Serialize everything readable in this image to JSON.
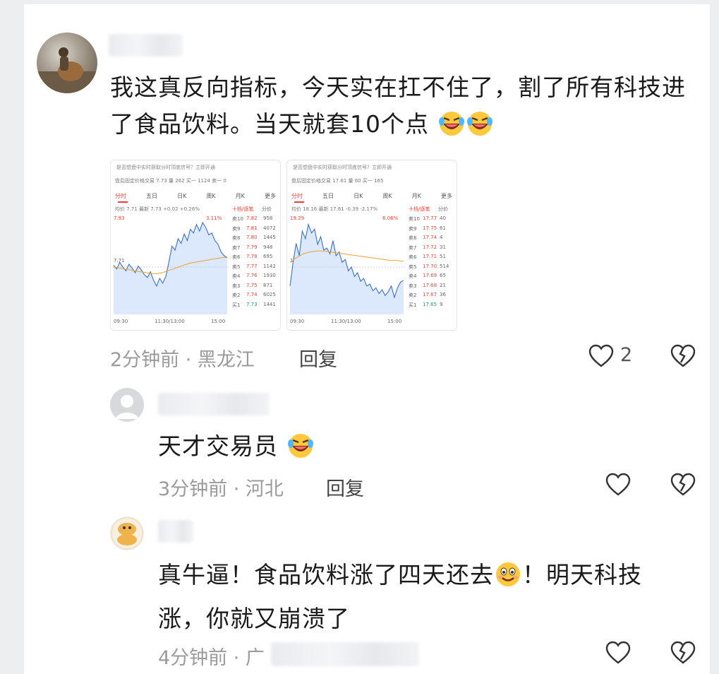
{
  "comments": [
    {
      "text_line1": "我这真反向指标，今天实在扛不住了，割了所有科技进",
      "text_line2": "了食品饮料。当天就套10个点",
      "time_location": "2分钟前 · 黑龙江",
      "reply_label": "回复",
      "like_count": "2",
      "images": [
        {
          "banner": "是否想盘中实时获取分时顶底信号？立即开通",
          "quote": "盘后固定价格交易 7.73 量 262 买一 1124 卖一 0",
          "tabs": [
            "分时",
            "五日",
            "日K",
            "周K",
            "月K",
            "更多"
          ],
          "stats": "均价 7.71 最新 7.73 +0.02 +0.26%",
          "top_price": "7.93",
          "top_pct": "3.11%",
          "bottom_price": "7.47",
          "bottom_pct": "-3.11%",
          "mid_label": "7.71",
          "axis_left": "09:30",
          "axis_mid": "11:30/13:00",
          "axis_right": "15:00",
          "book_header": "十档/逐笔",
          "book_header2": "分价",
          "book": [
            {
              "l": "卖10",
              "p": "7.82",
              "v": "958"
            },
            {
              "l": "卖9",
              "p": "7.81",
              "v": "4072"
            },
            {
              "l": "卖8",
              "p": "7.80",
              "v": "1445"
            },
            {
              "l": "卖7",
              "p": "7.79",
              "v": "948"
            },
            {
              "l": "卖6",
              "p": "7.78",
              "v": "695"
            },
            {
              "l": "卖5",
              "p": "7.77",
              "v": "1142"
            },
            {
              "l": "卖4",
              "p": "7.76",
              "v": "1930"
            },
            {
              "l": "卖3",
              "p": "7.75",
              "v": "871"
            },
            {
              "l": "卖2",
              "p": "7.74",
              "v": "6025"
            },
            {
              "l": "买1",
              "p": "7.73",
              "v": "1441"
            }
          ],
          "price_series": [
            0.52,
            0.48,
            0.55,
            0.5,
            0.46,
            0.53,
            0.49,
            0.44,
            0.51,
            0.47,
            0.42,
            0.39,
            0.45,
            0.36,
            0.3,
            0.38,
            0.33,
            0.4,
            0.55,
            0.72,
            0.68,
            0.8,
            0.75,
            0.85,
            0.78,
            0.9,
            0.86,
            0.95,
            0.88,
            0.97,
            0.92,
            0.84,
            0.86,
            0.78,
            0.74,
            0.66,
            0.62,
            0.6
          ],
          "avg_series": [
            0.5,
            0.49,
            0.48,
            0.47,
            0.46,
            0.45,
            0.44,
            0.43,
            0.43,
            0.44,
            0.46,
            0.48,
            0.5,
            0.52,
            0.54,
            0.55,
            0.56,
            0.57,
            0.58,
            0.59,
            0.6,
            0.6
          ],
          "signal_color": "#ff3b30"
        },
        {
          "banner": "是否想盘中实时获取分时顶底信号？立即开通",
          "quote": "盘后固定价格交易 17.61 量 60 买一 165",
          "tabs": [
            "分时",
            "五日",
            "日K",
            "周K",
            "月K",
            "更多"
          ],
          "stats": "均价 18.16 最新 17.61 -0.39 -2.17%",
          "top_price": "19.29",
          "top_pct": "6.06%",
          "bottom_price": "16.91",
          "bottom_pct": "-6.06%",
          "mid_label": "18.16",
          "axis_left": "09:30",
          "axis_mid": "11:30/13:00",
          "axis_right": "15:00",
          "book_header": "十档/逐笔",
          "book_header2": "分价",
          "book": [
            {
              "l": "卖10",
              "p": "17.77",
              "v": "40"
            },
            {
              "l": "卖9",
              "p": "17.75",
              "v": "61"
            },
            {
              "l": "卖8",
              "p": "17.74",
              "v": "4"
            },
            {
              "l": "卖7",
              "p": "17.72",
              "v": "31"
            },
            {
              "l": "卖6",
              "p": "17.71",
              "v": "51"
            },
            {
              "l": "卖5",
              "p": "17.70",
              "v": "514"
            },
            {
              "l": "卖4",
              "p": "17.69",
              "v": "65"
            },
            {
              "l": "卖3",
              "p": "17.68",
              "v": "21"
            },
            {
              "l": "卖2",
              "p": "17.67",
              "v": "36"
            },
            {
              "l": "买1",
              "p": "17.65",
              "v": "9"
            }
          ],
          "price_series": [
            0.3,
            0.55,
            0.75,
            0.62,
            0.88,
            0.8,
            0.95,
            0.86,
            0.9,
            0.74,
            0.82,
            0.68,
            0.7,
            0.64,
            0.78,
            0.62,
            0.66,
            0.55,
            0.58,
            0.46,
            0.5,
            0.4,
            0.44,
            0.35,
            0.38,
            0.3,
            0.32,
            0.25,
            0.28,
            0.22,
            0.26,
            0.2,
            0.24,
            0.3,
            0.18,
            0.28,
            0.34,
            0.36
          ],
          "avg_series": [
            0.55,
            0.6,
            0.64,
            0.66,
            0.67,
            0.67,
            0.66,
            0.65,
            0.64,
            0.63,
            0.62,
            0.61,
            0.6,
            0.59,
            0.58,
            0.57,
            0.57,
            0.56
          ],
          "signal_color": "#ff3b30"
        }
      ]
    },
    {
      "text_line1": "天才交易员",
      "time_location": "3分钟前 · 河北",
      "reply_label": "回复"
    },
    {
      "text_line1": "真牛逼！食品饮料涨了四天还去",
      "text_line1b": "！明天科技",
      "text_line2": "涨，你就又崩溃了",
      "time_location": "4分钟前 · 广"
    }
  ],
  "colors": {
    "up": "#ff3b30",
    "down": "#1aa260",
    "line": "#3b6fd8",
    "avg": "#f0a030",
    "area": "#dce8fb"
  },
  "icons": [
    "avatar",
    "laughing-crying-emoji",
    "smiling-emoji",
    "heart-outline-icon",
    "broken-heart-icon"
  ]
}
